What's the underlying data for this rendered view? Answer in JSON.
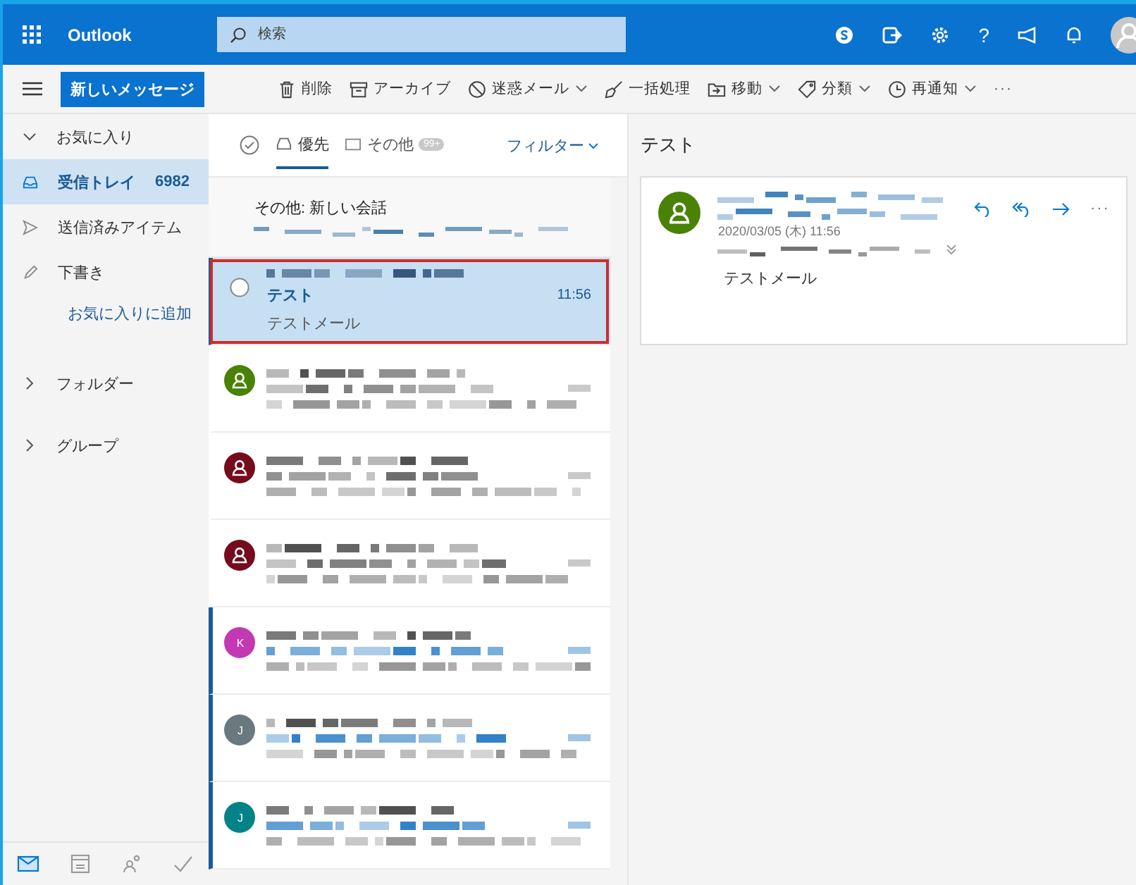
{
  "top_bar": {
    "app_name": "Outlook",
    "search": {
      "placeholder": "検索"
    },
    "help": "?"
  },
  "toolbar": {
    "new_message": "新しいメッセージ",
    "actions": [
      {
        "label": "削除",
        "dropdown": false
      },
      {
        "label": "アーカイブ",
        "dropdown": false
      },
      {
        "label": "迷惑メール",
        "dropdown": true
      },
      {
        "label": "一括処理",
        "dropdown": false
      },
      {
        "label": "移動",
        "dropdown": true
      },
      {
        "label": "分類",
        "dropdown": true
      },
      {
        "label": "再通知",
        "dropdown": true
      }
    ],
    "more": "···"
  },
  "sidebar": {
    "favorites": {
      "label": "お気に入り",
      "expanded": true
    },
    "items": [
      {
        "label": "受信トレイ",
        "count": "6982",
        "selected": true
      },
      {
        "label": "送信済みアイテム",
        "selected": false
      },
      {
        "label": "下書き",
        "selected": false
      }
    ],
    "add_favorite": "お気に入りに追加",
    "sections": [
      {
        "label": "フォルダー",
        "expanded": false
      },
      {
        "label": "グループ",
        "expanded": false
      }
    ],
    "nav": [
      {
        "selected": true
      },
      {
        "selected": false
      },
      {
        "selected": false
      },
      {
        "selected": false
      }
    ]
  },
  "message_list": {
    "tabs": [
      {
        "label": "優先",
        "selected": true
      },
      {
        "label": "その他",
        "badge": "99+",
        "selected": false
      }
    ],
    "filter": "フィルター",
    "other_summary": "その他: 新しい会話",
    "messages": [
      {
        "subject": "テスト",
        "time": "11:56",
        "preview": "テストメール",
        "selected": true,
        "unread": true,
        "highlighted": true
      },
      {
        "avatar": {
          "kind": "person",
          "color": "#498205"
        },
        "selected": false,
        "unread": false,
        "highlighted": false
      },
      {
        "avatar": {
          "kind": "person",
          "color": "#750b1c"
        },
        "selected": false,
        "unread": false,
        "highlighted": false
      },
      {
        "avatar": {
          "kind": "person",
          "color": "#750b1c"
        },
        "selected": false,
        "unread": false,
        "highlighted": false
      },
      {
        "avatar": {
          "kind": "letter",
          "letter": "K",
          "color": "#c239b3"
        },
        "selected": false,
        "unread": true,
        "highlighted": false
      },
      {
        "avatar": {
          "kind": "letter",
          "letter": "J",
          "color": "#69797e"
        },
        "selected": false,
        "unread": true,
        "highlighted": false
      },
      {
        "avatar": {
          "kind": "letter",
          "letter": "J",
          "color": "#038387"
        },
        "selected": false,
        "unread": true,
        "highlighted": false
      }
    ]
  },
  "reading_pane": {
    "subject": "テスト",
    "date": "2020/03/05 (木) 11:56",
    "body": "テストメール",
    "more": "···"
  }
}
